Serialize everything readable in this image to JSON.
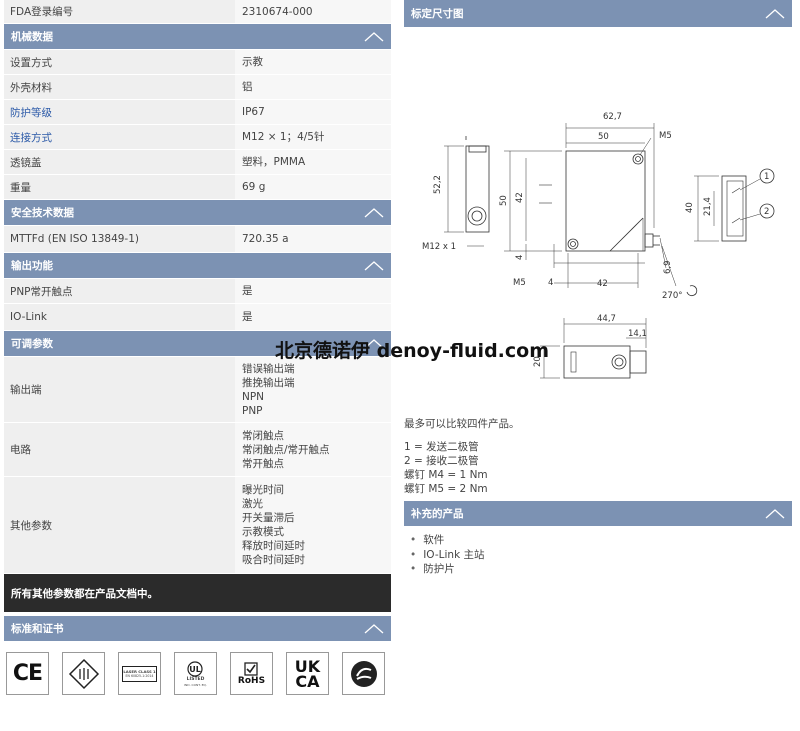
{
  "left": {
    "top_row": {
      "key": "FDA登录编号",
      "value": "2310674-000"
    },
    "mechanical": {
      "title": "机械数据",
      "rows": [
        {
          "key": "设置方式",
          "value": "示教",
          "link": false
        },
        {
          "key": "外壳材料",
          "value": "铝",
          "link": false
        },
        {
          "key": "防护等级",
          "value": "IP67",
          "link": true
        },
        {
          "key": "连接方式",
          "value": "M12 × 1；4/5针",
          "link": true
        },
        {
          "key": "透镜盖",
          "value": "塑料，PMMA",
          "link": false
        },
        {
          "key": "重量",
          "value": "69 g",
          "link": false
        }
      ]
    },
    "safety": {
      "title": "安全技术数据",
      "rows": [
        {
          "key": "MTTFd (EN ISO 13849-1)",
          "value": "720.35 a"
        }
      ]
    },
    "output": {
      "title": "输出功能",
      "rows": [
        {
          "key": "PNP常开触点",
          "value": "是"
        },
        {
          "key": "IO-Link",
          "value": "是"
        }
      ]
    },
    "adjustable": {
      "title": "可调参数",
      "rows": [
        {
          "key": "输出端",
          "values": [
            "错误输出端",
            "推挽输出端",
            "NPN",
            "PNP"
          ]
        },
        {
          "key": "电路",
          "values": [
            "常闭触点",
            "常闭触点/常开触点",
            "常开触点"
          ]
        },
        {
          "key": "其他参数",
          "values": [
            "曝光时间",
            "激光",
            "开关量滞后",
            "示教模式",
            "释放时间延时",
            "吸合时间延时"
          ]
        }
      ]
    },
    "note_bar": "所有其他参数都在产品文档中。",
    "standards": {
      "title": "标准和证书"
    },
    "cert_badges": {
      "laser_line1": "LASER CLASS 1",
      "laser_line2": "EN 60825-1:2014",
      "ul_text": "LISTED",
      "ul_small": "IND. CONT. EQ.",
      "rohs": "RoHS",
      "ukca_top": "UK",
      "ukca_bottom": "CA",
      "ce": "CE"
    }
  },
  "right": {
    "dimension": {
      "title": "标定尺寸图",
      "labels": {
        "d62_7": "62,7",
        "d50_top": "50",
        "m5_top": "M5",
        "d52_2": "52,2",
        "d50_left": "50",
        "d42_v": "42",
        "d40": "40",
        "d21_4": "21,4",
        "n1": "1",
        "n2": "2",
        "d4_v": "4",
        "m12": "M12 x 1",
        "m5_bot": "M5",
        "d4_h": "4",
        "d42_h": "42",
        "d6_9": "6,9",
        "d270": "270°",
        "d44_7": "44,7",
        "d14_1": "14,1",
        "d20": "20"
      }
    },
    "compare_text": "最多可以比较四件产品。",
    "legend": [
      "1 = 发送二极管",
      "2 = 接收二极管",
      "螺钉 M4 = 1 Nm",
      "螺钉 M5 = 2 Nm"
    ],
    "supplementary": {
      "title": "补充的产品",
      "items": [
        "软件",
        "IO-Link 主站",
        "防护片"
      ]
    }
  },
  "watermark": "北京德诺伊 denoy-fluid.com",
  "colors": {
    "header": "#7c92b3",
    "link": "#2c5aa8",
    "dark_bar": "#2b2b2b",
    "key_bg": "#efefef",
    "val_bg": "#f7f7f7"
  }
}
